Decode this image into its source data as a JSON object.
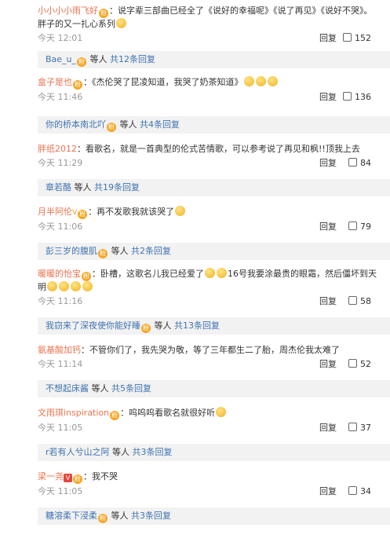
{
  "comments": [
    {
      "avatar": "a0",
      "name": "小小小小雨飞好",
      "text": "：说字辈三部曲已经全了《说好的幸福呢》《说了再见》《说好不哭》。胖子的又一扎心系列",
      "time": "今天 12:01",
      "reply": "回复",
      "likes": "152",
      "sub": {
        "name": "Bae_u_",
        "rest": " 等人 ",
        "link": "共12条回复"
      }
    },
    {
      "avatar": "a1",
      "name": "盒子是也",
      "text": "：《杰伦哭了昆凌知道，我哭了奶茶知道》",
      "time": "今天 11:46",
      "reply": "回复",
      "likes": "136",
      "sub": {
        "name": "你的桥本南北吖",
        "rest": " 等人 ",
        "link": "共4条回复"
      }
    },
    {
      "avatar": "a2",
      "name": "胖纸2012",
      "text": "：看歌名，就是一首典型的伦式苦情歌，可以参考说了再见和枫!!顶我上去",
      "time": "今天 11:29",
      "reply": "回复",
      "likes": "84",
      "sub": {
        "name": "章若酪",
        "rest": " 等人 ",
        "link": "共19条回复"
      }
    },
    {
      "avatar": "a3",
      "name": "月半阿伦",
      "text": "：再不发歌我就该哭了",
      "time": "今天 11:06",
      "reply": "回复",
      "likes": "79",
      "sub": {
        "name": "彭三岁的腹肌",
        "rest": " 等人 ",
        "link": "共2条回复"
      }
    },
    {
      "avatar": "a4",
      "name": "暖暖的怡宝",
      "text": "：卧槽，这歌名儿我已经爱了",
      "text2": "16号我要涂最贵的眼霜，然后僵坏到天明",
      "time": "今天 11:16",
      "reply": "回复",
      "likes": "58",
      "sub": {
        "name": "我窃来了深夜使你能好睡",
        "rest": " 等人 ",
        "link": "共13条回复"
      }
    },
    {
      "avatar": "a5",
      "name": "氨基酸加钙",
      "text": "：不管你们了，我先哭为敬，等了三年都生二了胎，周杰伦我太难了",
      "time": "今天 11:14",
      "reply": "回复",
      "likes": "52",
      "sub": {
        "name": "不想起床酱",
        "rest": " 等人 ",
        "link": "共5条回复"
      }
    },
    {
      "avatar": "a6",
      "name": "文雨琪inspiration",
      "text": "：呜呜呜看歌名就很好听",
      "time": "今天 11:05",
      "reply": "回复",
      "likes": "37",
      "sub": {
        "name": "r若有人兮山之阿",
        "rest": " 等人 ",
        "link": "共3条回复"
      }
    },
    {
      "avatar": "a7",
      "name": "梁一尧",
      "text": "：我不哭",
      "time": "今天 11:05",
      "reply": "回复",
      "likes": "34",
      "sub": {
        "name": "糖溶柔下浸柔",
        "rest": " 等人 ",
        "link": "共3条回复"
      }
    }
  ]
}
